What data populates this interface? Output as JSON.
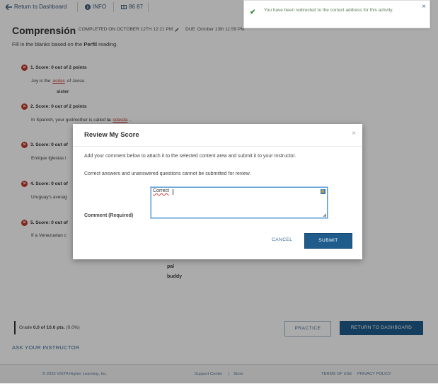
{
  "top_bar": {
    "return_label": "Return to Dashboard",
    "info_label": "INFO",
    "code_label": "86 87"
  },
  "toast": {
    "message": "You have been redirected to the correct address for this activity.",
    "close": "×"
  },
  "header": {
    "title": "Comprensión",
    "completed": "COMPLETED ON OCTOBER 12TH 12:21 PM",
    "due_label": "DUE",
    "due_date": "October 13th 11:59 PM"
  },
  "instructions": {
    "prefix": "Fill in the blanks based on the ",
    "reading": "Perfil",
    "suffix": " reading."
  },
  "questions": [
    {
      "head": "1.  Score: 0 out of 2 points",
      "before": "Joy is the",
      "answer": "asdas",
      "after": "of Jesse.",
      "option": "sister"
    },
    {
      "head": "2.  Score: 0 out of 2 points",
      "before": "In Spanish, your godmother is called",
      "prefix": "la",
      "answer": "sdasda",
      "after": "."
    },
    {
      "head": "3.  Score: 0 out of",
      "before": "Enrique Iglesias i"
    },
    {
      "head": "4.  Score: 0 out of",
      "before": "Uruguay's averag"
    },
    {
      "head": "5.  Score: 0 out of",
      "before": "If a Venezuelan c",
      "options": [
        "pal",
        "buddy"
      ]
    }
  ],
  "grade": {
    "label": "Grade",
    "value": "0.0 of 10.0 pts.",
    "percent": "(0.0%)"
  },
  "buttons": {
    "practice": "PRACTICE",
    "return_dashboard": "RETURN TO DASHBOARD",
    "ask_instructor": "ASK YOUR INSTRUCTOR"
  },
  "footer": {
    "copyright": "© 2022 VISTA Higher Learning, Inc.",
    "support": "Support Center",
    "divider": "|",
    "store": "Store",
    "terms": "TERMS OF USE",
    "privacy": "PRIVACY POLICY"
  },
  "modal": {
    "title": "Review My Score",
    "close": "×",
    "p1": "Add your comment below to attach it to the selected content area and submit it to your Instructor.",
    "p2": "Correct answers and unanswered questions cannot be submitted for review.",
    "comment_label": "Comment (Required)",
    "comment_value": "Correct",
    "cancel": "CANCEL",
    "submit": "SUBMIT"
  },
  "colors": {
    "primary": "#1f5c8c",
    "error": "#c0392b",
    "success": "#3a8a3a"
  }
}
